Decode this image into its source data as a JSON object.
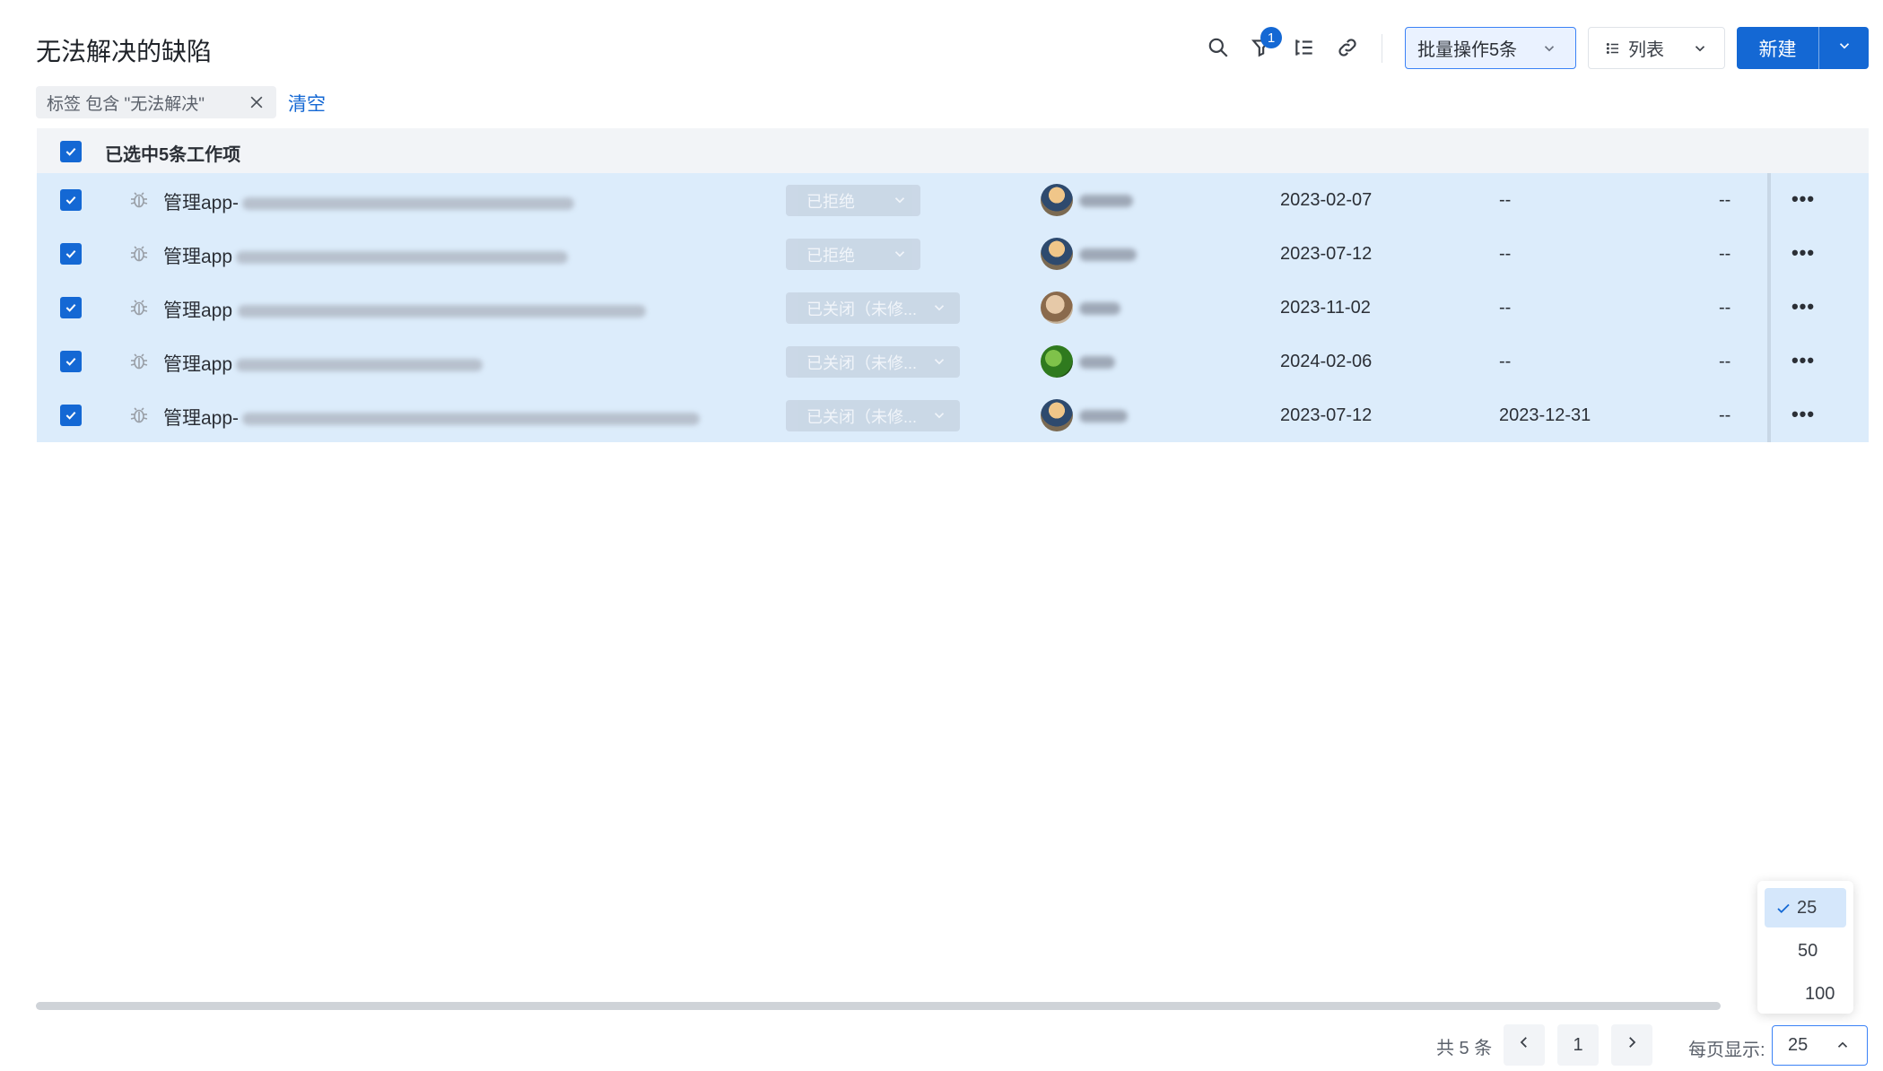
{
  "header": {
    "title": "无法解决的缺陷",
    "filter_badge": "1",
    "batch_label": "批量操作5条",
    "view_label": "列表",
    "new_label": "新建"
  },
  "filter": {
    "chip_label": "标签 包含 \"无法解决\"",
    "clear_label": "清空"
  },
  "table": {
    "selected_text": "已选中5条工作项",
    "rows": [
      {
        "title_prefix": "管理app-",
        "status": "已拒绝",
        "date1": "2023-02-07",
        "date2": "--",
        "col3": "--"
      },
      {
        "title_prefix": "管理app",
        "status": "已拒绝",
        "date1": "2023-07-12",
        "date2": "--",
        "col3": "--"
      },
      {
        "title_prefix": "管理app",
        "status": "已关闭（未修...",
        "date1": "2023-11-02",
        "date2": "--",
        "col3": "--"
      },
      {
        "title_prefix": "管理app",
        "status": "已关闭（未修...",
        "date1": "2024-02-06",
        "date2": "--",
        "col3": "--"
      },
      {
        "title_prefix": "管理app-",
        "status": "已关闭（未修...",
        "date1": "2023-07-12",
        "date2": "2023-12-31",
        "col3": "--"
      }
    ]
  },
  "pagination": {
    "total": "共 5 条",
    "page": "1",
    "per_page_label": "每页显示:",
    "per_page_value": "25",
    "options": [
      "25",
      "50",
      "100"
    ]
  },
  "colors": {
    "accent": "#1468d4",
    "row_selected": "#dcecfb"
  }
}
